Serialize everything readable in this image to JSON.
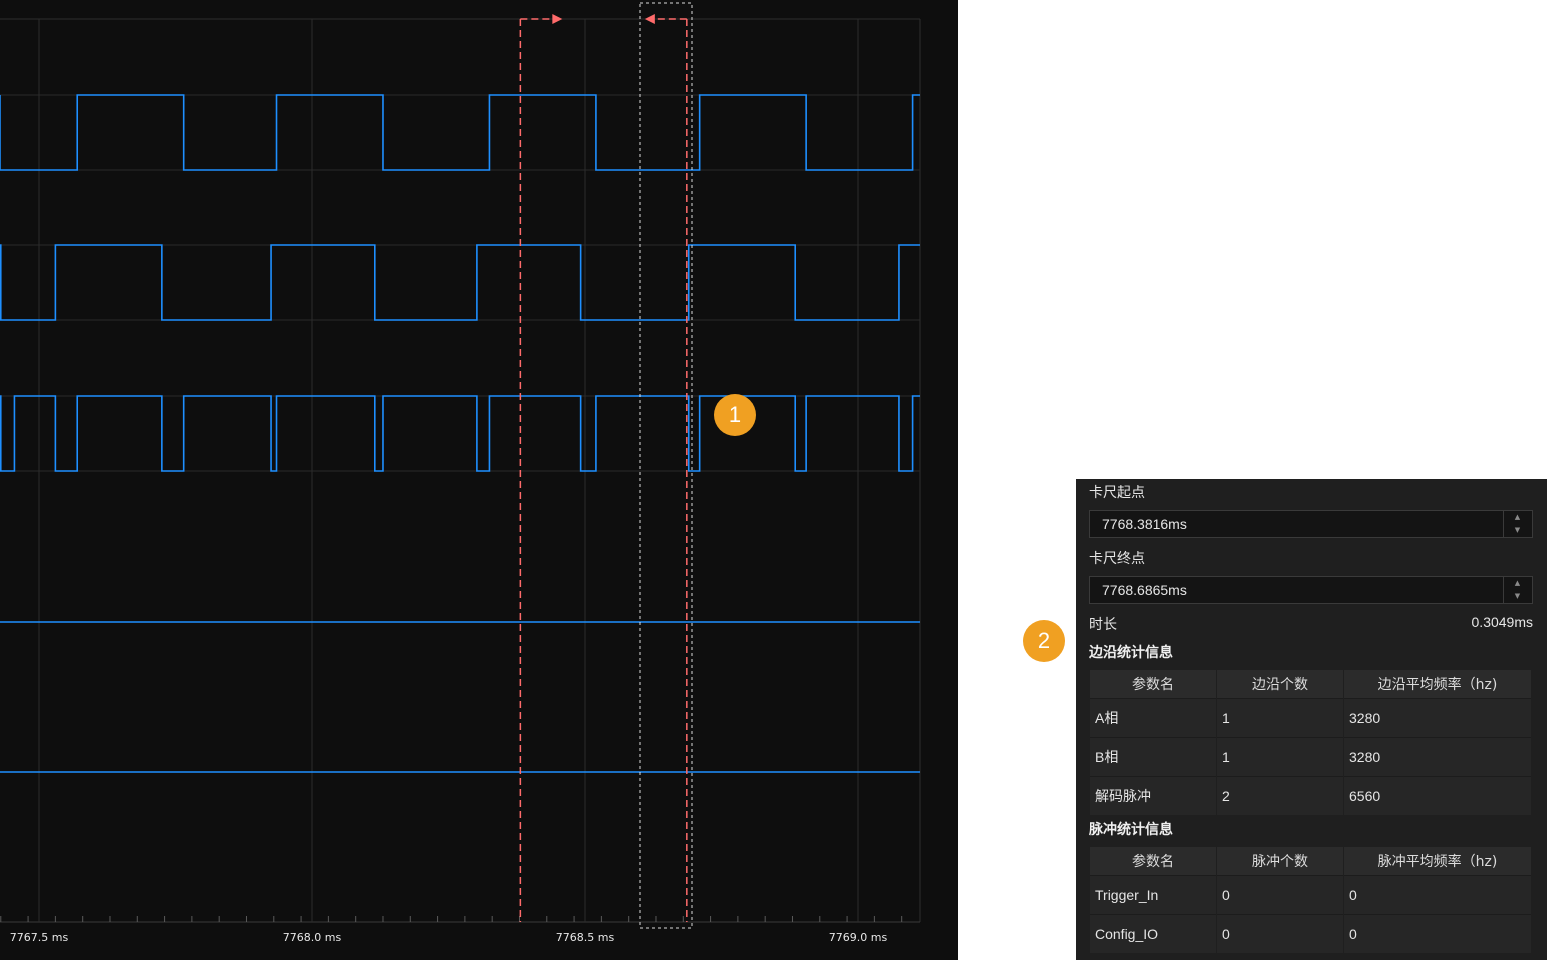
{
  "colors": {
    "waveform": "#1e8fff",
    "cursor_start": "#ff6b6b",
    "cursor_end": "#ff6b6b",
    "selection_box": "#ffffff",
    "badge": "#f0a022",
    "scope_background": "#0e0e0e"
  },
  "chart_data": {
    "type": "line",
    "title": "",
    "xlabel": "",
    "ylabel": "",
    "x_unit": "ms",
    "xlim": [
      7767.43,
      7769.11
    ],
    "tick_labels": [
      "7767.5 ms",
      "7768.0 ms",
      "7768.5 ms",
      "7769.0 ms"
    ],
    "tick_values": [
      7767.5,
      7768.0,
      7768.5,
      7769.0
    ],
    "grid": true,
    "cursors": {
      "start": 7768.3816,
      "end": 7768.6865
    },
    "series": [
      {
        "initial_level": 1,
        "transitions": [
          7767.4,
          7767.57,
          7767.765,
          7767.935,
          7768.13,
          7768.325,
          7768.52,
          7768.71,
          7768.905,
          7769.1
        ]
      },
      {
        "initial_level": 1,
        "transitions": [
          7767.43,
          7767.53,
          7767.725,
          7767.925,
          7768.115,
          7768.302,
          7768.492,
          7768.69,
          7768.885,
          7769.075
        ]
      },
      {
        "initial_level": 1,
        "transitions": [
          7767.43,
          7767.455,
          7767.53,
          7767.57,
          7767.725,
          7767.765,
          7767.925,
          7767.935,
          7768.115,
          7768.13,
          7768.302,
          7768.325,
          7768.492,
          7768.52,
          7768.69,
          7768.71,
          7768.885,
          7768.905,
          7769.075,
          7769.1
        ]
      },
      {
        "initial_level": 0,
        "transitions": []
      },
      {
        "initial_level": 0,
        "transitions": []
      }
    ]
  },
  "badges": {
    "one": "1",
    "two": "2"
  },
  "panel": {
    "caliper_start_label": "卡尺起点",
    "caliper_start_value": "7768.3816ms",
    "caliper_end_label": "卡尺终点",
    "caliper_end_value": "7768.6865ms",
    "duration_label": "时长",
    "duration_value": "0.3049ms",
    "edge_section_title": "边沿统计信息",
    "edge_table": {
      "headers": [
        "参数名",
        "边沿个数",
        "边沿平均频率（hz)"
      ],
      "rows": [
        [
          "A相",
          "1",
          "3280"
        ],
        [
          "B相",
          "1",
          "3280"
        ],
        [
          "解码脉冲",
          "2",
          "6560"
        ]
      ]
    },
    "pulse_section_title": "脉冲统计信息",
    "pulse_table": {
      "headers": [
        "参数名",
        "脉冲个数",
        "脉冲平均频率（hz)"
      ],
      "rows": [
        [
          "Trigger_In",
          "0",
          "0"
        ],
        [
          "Config_IO",
          "0",
          "0"
        ]
      ]
    }
  }
}
